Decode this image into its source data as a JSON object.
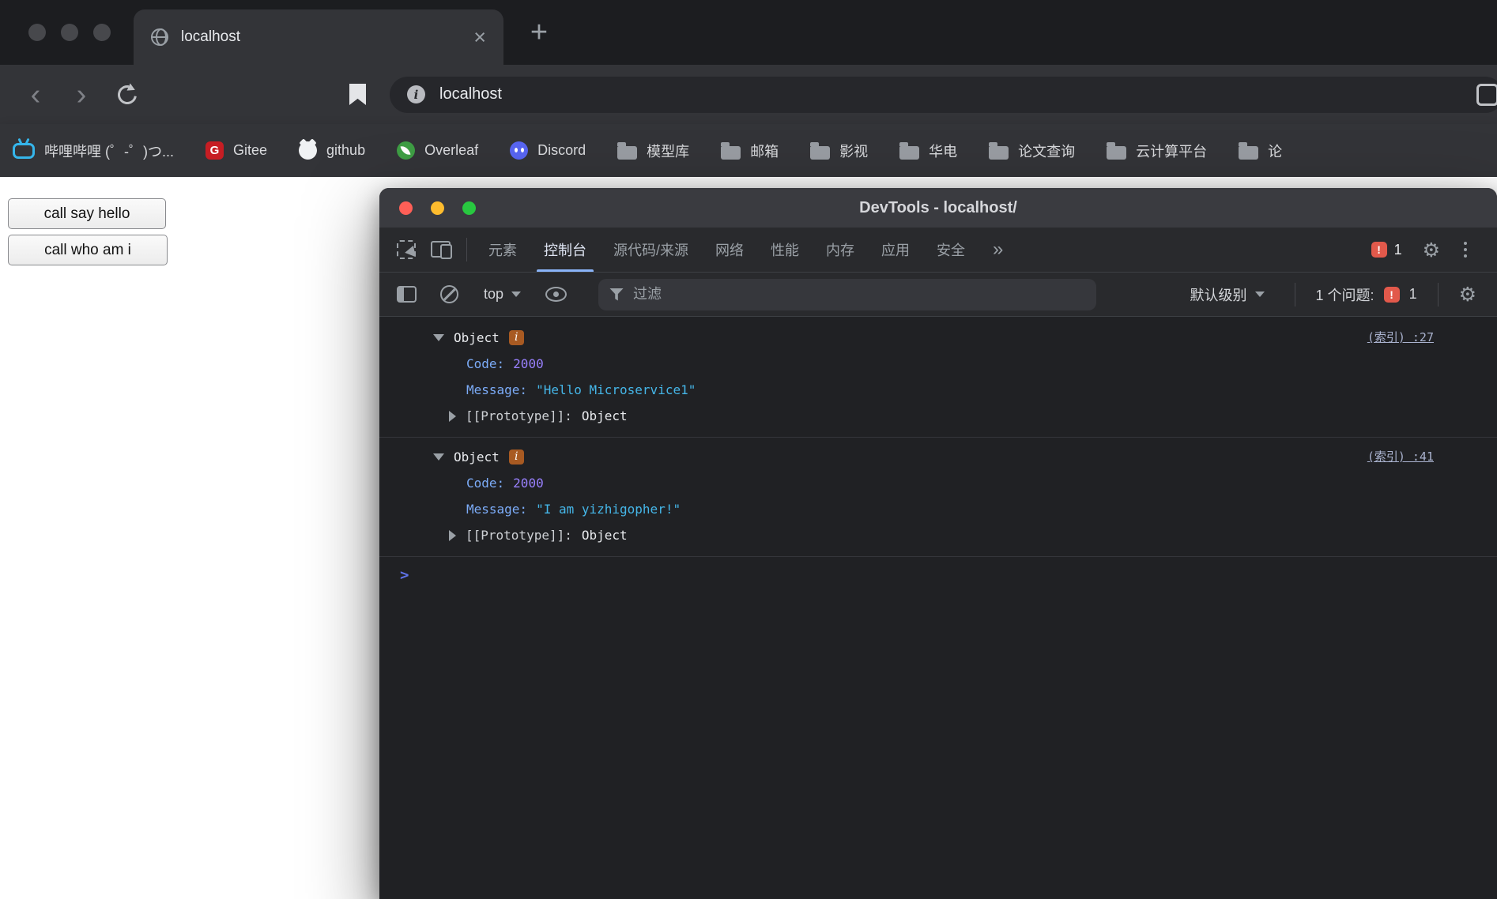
{
  "colors": {
    "accent_blue": "#8ab4f8",
    "key_blue": "#7cacf8",
    "number_purple": "#9980ff",
    "string_cyan": "#45b6e8",
    "error_red": "#e2594b",
    "devtools_bg": "#202124",
    "chrome_bg": "#333438"
  },
  "browser": {
    "tab": {
      "title": "localhost",
      "close_glyph": "×",
      "new_tab_glyph": "+"
    },
    "nav": {
      "back_glyph": "‹",
      "forward_glyph": "›",
      "url": "localhost",
      "info_glyph": "i"
    },
    "bookmarks": [
      {
        "label": "哔哩哔哩 (゜-゜)つ...",
        "icon": "bilibili-icon"
      },
      {
        "label": "Gitee",
        "icon": "gitee-icon",
        "monogram": "G"
      },
      {
        "label": "github",
        "icon": "github-icon"
      },
      {
        "label": "Overleaf",
        "icon": "overleaf-icon"
      },
      {
        "label": "Discord",
        "icon": "discord-icon"
      },
      {
        "label": "模型库",
        "icon": "folder-icon"
      },
      {
        "label": "邮箱",
        "icon": "folder-icon"
      },
      {
        "label": "影视",
        "icon": "folder-icon"
      },
      {
        "label": "华电",
        "icon": "folder-icon"
      },
      {
        "label": "论文查询",
        "icon": "folder-icon"
      },
      {
        "label": "云计算平台",
        "icon": "folder-icon"
      },
      {
        "label": "论",
        "icon": "folder-icon"
      }
    ]
  },
  "page": {
    "buttons": [
      {
        "label": "call say hello"
      },
      {
        "label": "call who am i"
      }
    ]
  },
  "devtools": {
    "title": "DevTools - localhost/",
    "tabs": [
      {
        "label": "元素"
      },
      {
        "label": "控制台"
      },
      {
        "label": "源代码/来源"
      },
      {
        "label": "网络"
      },
      {
        "label": "性能"
      },
      {
        "label": "内存"
      },
      {
        "label": "应用"
      },
      {
        "label": "安全"
      }
    ],
    "more_glyph": "»",
    "header": {
      "error_count": "1",
      "error_glyph": "!"
    },
    "toolbar": {
      "context": "top",
      "filter_placeholder": "过滤",
      "levels_label": "默认级别",
      "issues_label": "1 个问题:",
      "issues_count": "1"
    },
    "console": {
      "prompt_glyph": ">",
      "messages": [
        {
          "preview": "Object",
          "badge": "i",
          "source": "(索引) :27",
          "props": [
            {
              "key": "Code:",
              "value": "2000"
            },
            {
              "key": "Message:",
              "value": "\"Hello Microservice1\""
            }
          ],
          "proto_key": "[[Prototype]]:",
          "proto_value": "Object"
        },
        {
          "preview": "Object",
          "badge": "i",
          "source": "(索引) :41",
          "props": [
            {
              "key": "Code:",
              "value": "2000"
            },
            {
              "key": "Message:",
              "value": "\"I am yizhigopher!\""
            }
          ],
          "proto_key": "[[Prototype]]:",
          "proto_value": "Object"
        }
      ]
    }
  }
}
